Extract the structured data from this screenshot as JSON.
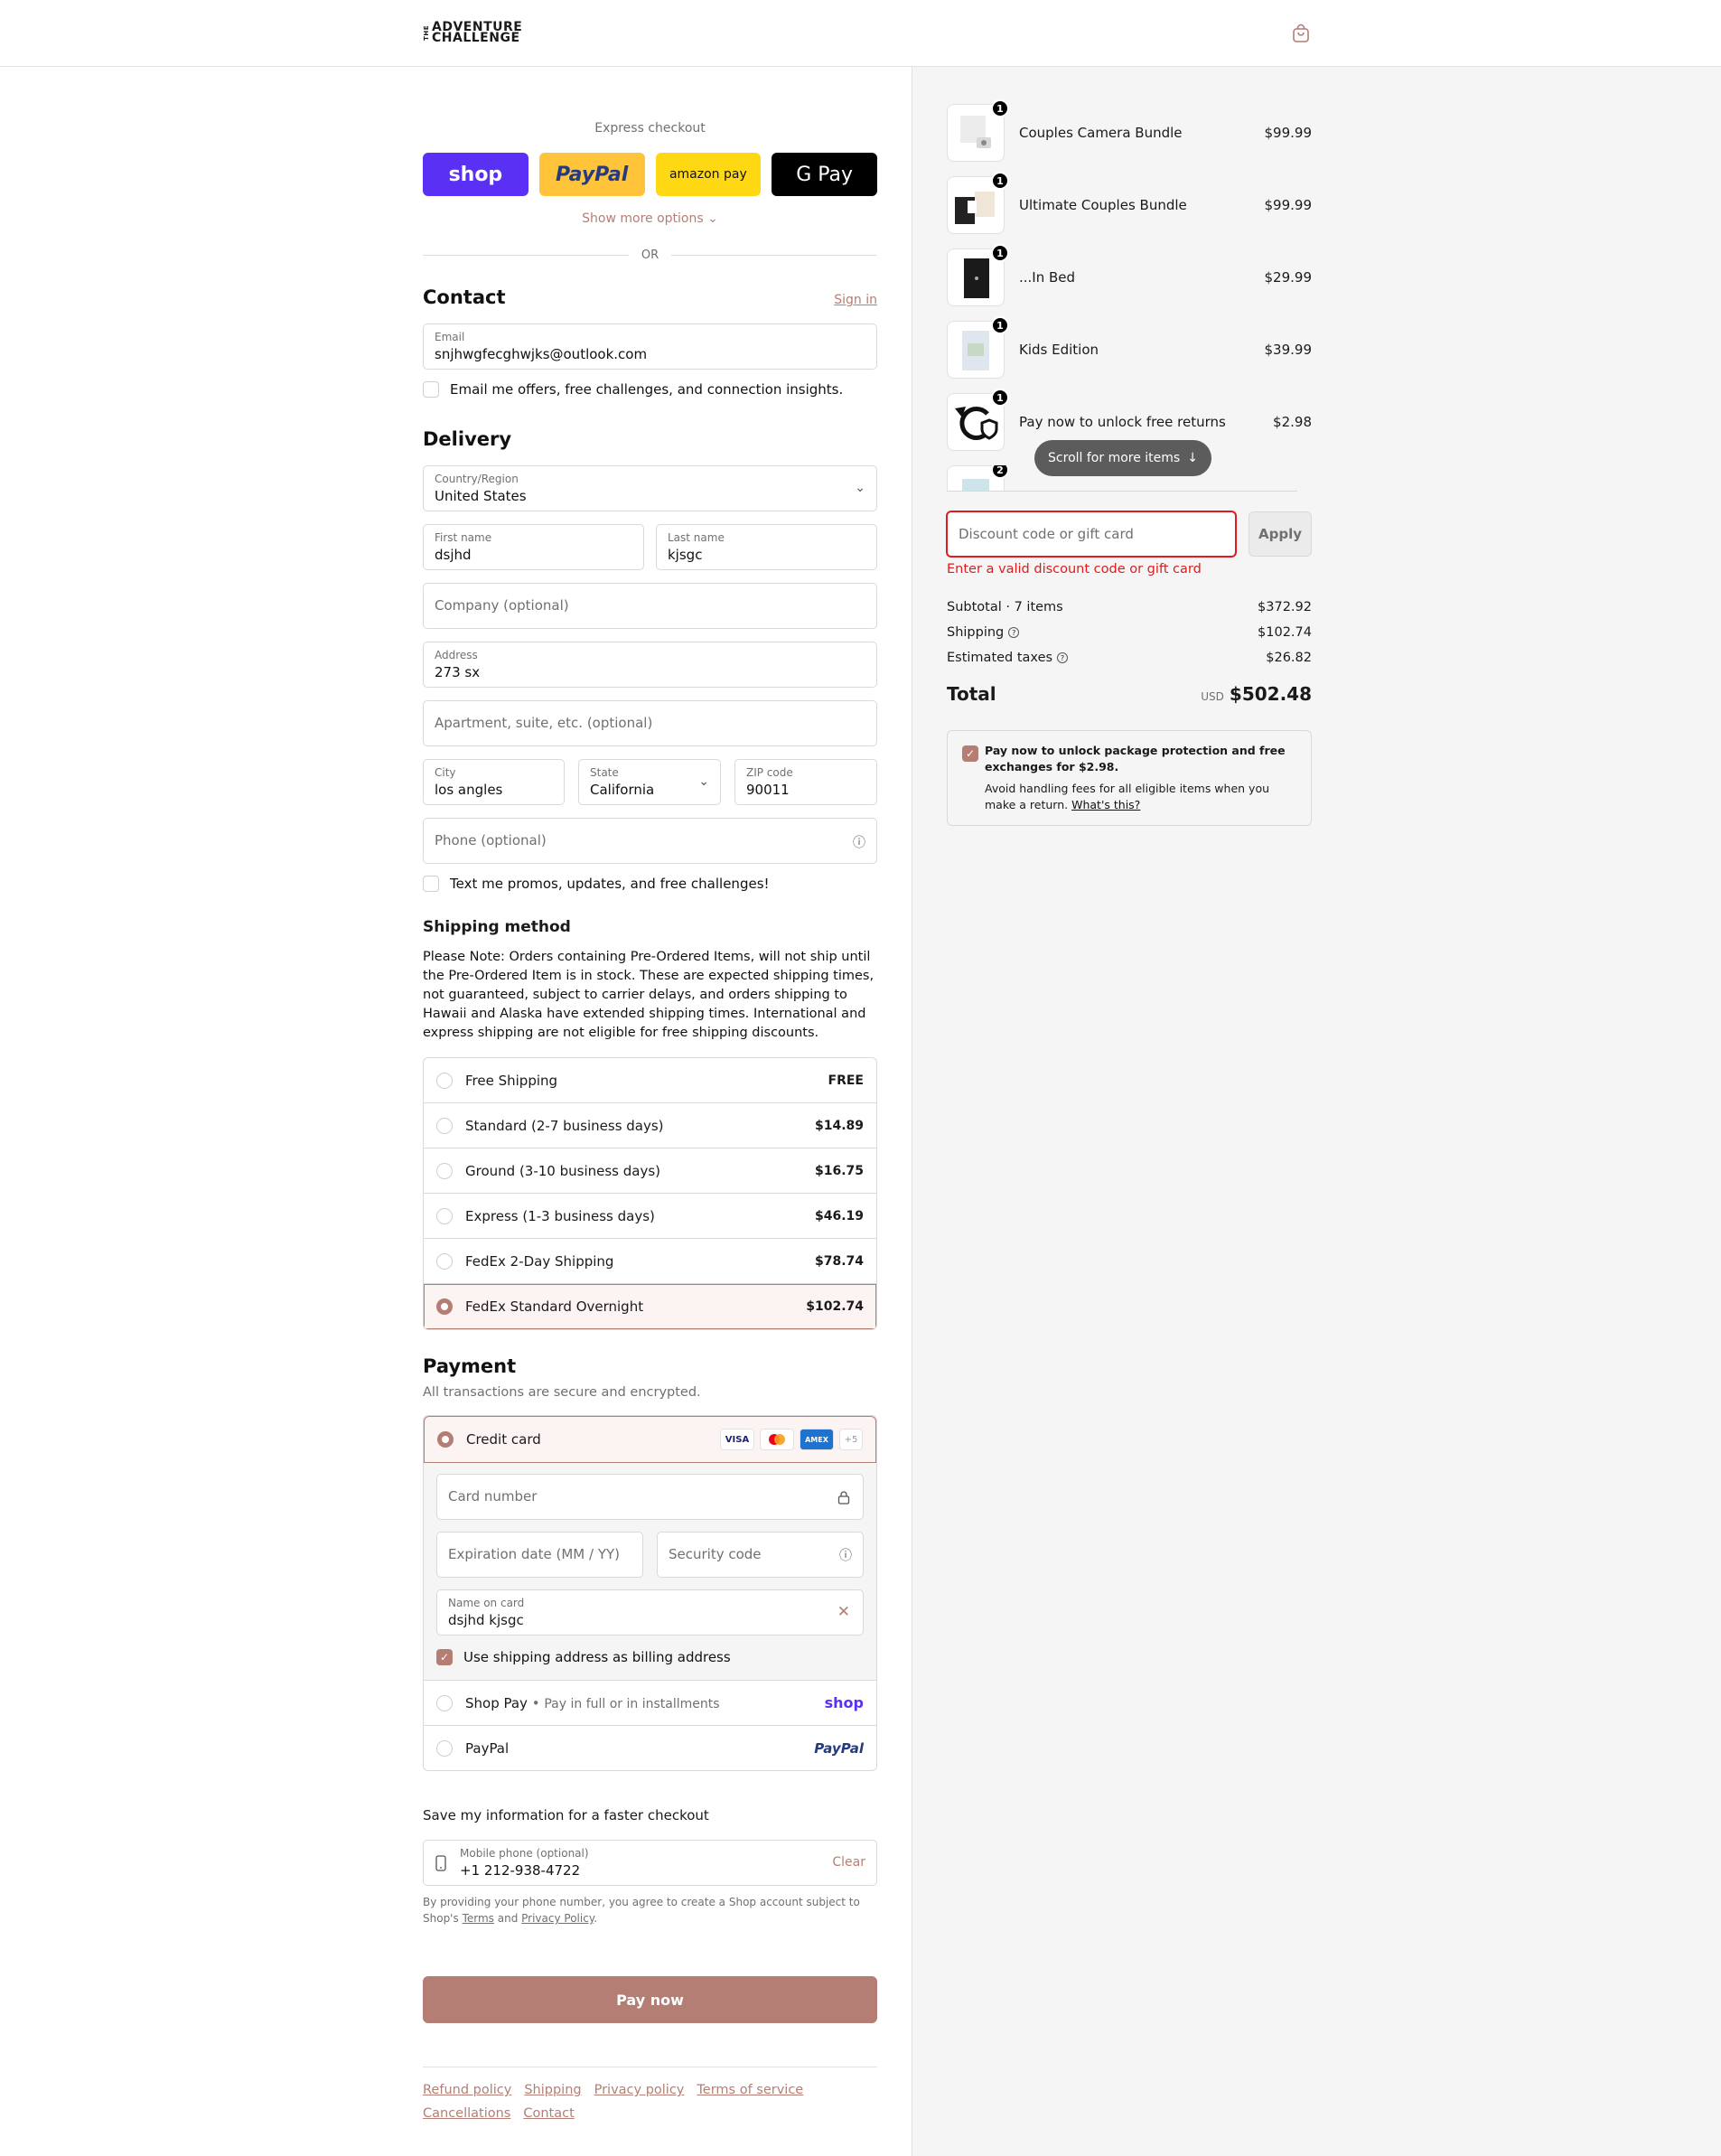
{
  "header": {
    "logo_the": "THE",
    "logo_line1": "ADVENTURE",
    "logo_line2": "CHALLENGE"
  },
  "express": {
    "title": "Express checkout",
    "shop": "shop",
    "paypal": "PayPal",
    "amazon": "amazon pay",
    "gpay": "G Pay",
    "show_more": "Show more options",
    "or": "OR"
  },
  "contact": {
    "heading": "Contact",
    "sign_in": "Sign in",
    "email_label": "Email",
    "email_value": "snjhwgfecghwjks@outlook.com",
    "offers_label": "Email me offers, free challenges, and connection insights."
  },
  "delivery": {
    "heading": "Delivery",
    "country_label": "Country/Region",
    "country_value": "United States",
    "first_label": "First name",
    "first_value": "dsjhd",
    "last_label": "Last name",
    "last_value": "kjsgc",
    "company_ph": "Company (optional)",
    "address_label": "Address",
    "address_value": "273 sx",
    "apt_ph": "Apartment, suite, etc. (optional)",
    "city_label": "City",
    "city_value": "los angles",
    "state_label": "State",
    "state_value": "California",
    "zip_label": "ZIP code",
    "zip_value": "90011",
    "phone_ph": "Phone (optional)",
    "sms_label": "Text me promos, updates, and free challenges!"
  },
  "shipping": {
    "heading": "Shipping method",
    "note": "Please Note: Orders containing Pre-Ordered Items, will not ship until the Pre-Ordered Item is in stock. These are expected shipping times, not guaranteed, subject to carrier delays, and orders shipping to Hawaii and Alaska have extended shipping times. International and express shipping are not eligible for free shipping discounts.",
    "options": [
      {
        "name": "Free Shipping",
        "price": "FREE",
        "selected": false
      },
      {
        "name": "Standard (2-7 business days)",
        "price": "$14.89",
        "selected": false
      },
      {
        "name": "Ground (3-10 business days)",
        "price": "$16.75",
        "selected": false
      },
      {
        "name": "Express (1-3 business days)",
        "price": "$46.19",
        "selected": false
      },
      {
        "name": "FedEx 2-Day Shipping",
        "price": "$78.74",
        "selected": false
      },
      {
        "name": "FedEx Standard Overnight",
        "price": "$102.74",
        "selected": true
      }
    ]
  },
  "payment": {
    "heading": "Payment",
    "sub": "All transactions are secure and encrypted.",
    "cc_label": "Credit card",
    "card_visa": "VISA",
    "card_amex": "AMEX",
    "card_more": "+5",
    "card_number_ph": "Card number",
    "exp_ph": "Expiration date (MM / YY)",
    "cvc_ph": "Security code",
    "name_label": "Name on card",
    "name_value": "dsjhd kjsgc",
    "billing_label": "Use shipping address as billing address",
    "shoppay_label": "Shop Pay",
    "shoppay_sub": "Pay in full or in installments",
    "shoppay_logo": "shop",
    "paypal_label": "PayPal",
    "paypal_logo": "PayPal"
  },
  "save": {
    "title": "Save my information for a faster checkout",
    "phone_label": "Mobile phone (optional)",
    "phone_value": "+1 212-938-4722",
    "clear": "Clear",
    "terms_pre": "By providing your phone number, you agree to create a Shop account subject to Shop's",
    "terms_link": "Terms",
    "and": "and",
    "privacy_link": "Privacy Policy",
    "period": "."
  },
  "pay_now": "Pay now",
  "footer": [
    "Refund policy",
    "Shipping",
    "Privacy policy",
    "Terms of service",
    "Cancellations",
    "Contact"
  ],
  "order": {
    "items": [
      {
        "name": "Couples Camera Bundle",
        "price": "$99.99",
        "qty": "1"
      },
      {
        "name": "Ultimate Couples Bundle",
        "price": "$99.99",
        "qty": "1"
      },
      {
        "name": "...In Bed",
        "price": "$29.99",
        "qty": "1"
      },
      {
        "name": "Kids Edition",
        "price": "$39.99",
        "qty": "1"
      },
      {
        "name": "Pay now to unlock free returns",
        "price": "$2.98",
        "qty": "1"
      }
    ],
    "partial_qty": "2",
    "scroll_pill": "Scroll for more items",
    "discount_ph": "Discount code or gift card",
    "apply": "Apply",
    "discount_error": "Enter a valid discount code or gift card",
    "subtotal_label": "Subtotal · 7 items",
    "subtotal": "$372.92",
    "shipping_label": "Shipping",
    "shipping": "$102.74",
    "taxes_label": "Estimated taxes",
    "taxes": "$26.82",
    "total_label": "Total",
    "currency": "USD",
    "total": "$502.48",
    "protect_title": "Pay now to unlock package protection and free exchanges for $2.98.",
    "protect_desc": "Avoid handling fees for all eligible items when you make a return.",
    "protect_link": "What's this?"
  },
  "colors": {
    "accent": "#b47e74",
    "error": "#dd1d1d",
    "shop": "#5a31f4"
  }
}
